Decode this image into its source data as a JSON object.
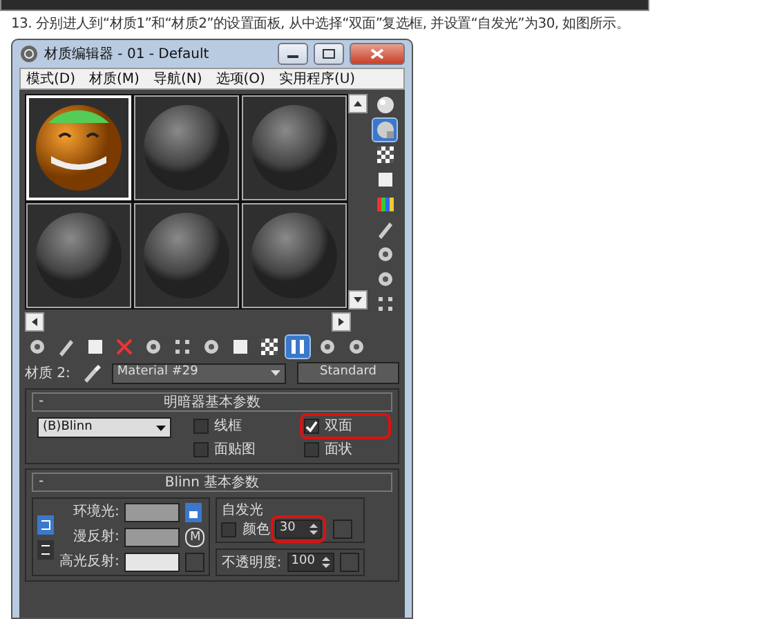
{
  "instruction": "13. 分别进人到“材质1”和“材质2”的设置面板, 从中选择“双面”复选框, 并设置“自发光”为30, 如图所示。",
  "window": {
    "title": "材质编辑器 - 01 - Default"
  },
  "menu": [
    "模式(D)",
    "材质(M)",
    "导航(N)",
    "选项(O)",
    "实用程序(U)"
  ],
  "samples": [
    {
      "kind": "textured",
      "selected": true
    },
    {
      "kind": "plain",
      "selected": false
    },
    {
      "kind": "plain",
      "selected": false
    },
    {
      "kind": "plain",
      "selected": false
    },
    {
      "kind": "plain",
      "selected": false
    },
    {
      "kind": "plain",
      "selected": false
    }
  ],
  "side_tools": [
    {
      "kind": "sphere",
      "selected": false
    },
    {
      "kind": "backlight",
      "selected": true
    },
    {
      "kind": "checker",
      "selected": false
    },
    {
      "kind": "square",
      "selected": false
    },
    {
      "kind": "colorbars",
      "selected": false
    },
    {
      "kind": "pen",
      "selected": false
    },
    {
      "kind": "cog",
      "selected": false
    },
    {
      "kind": "cog",
      "selected": false
    },
    {
      "kind": "dots",
      "selected": false
    }
  ],
  "toolbar": [
    {
      "kind": "cog",
      "selected": false
    },
    {
      "kind": "pen",
      "selected": false
    },
    {
      "kind": "square",
      "selected": false
    },
    {
      "kind": "delete",
      "selected": false
    },
    {
      "kind": "cog",
      "selected": false
    },
    {
      "kind": "dots",
      "selected": false
    },
    {
      "kind": "cog",
      "selected": false
    },
    {
      "kind": "square",
      "selected": false
    },
    {
      "kind": "checker",
      "selected": false
    },
    {
      "kind": "bars",
      "selected": true
    },
    {
      "kind": "cog",
      "selected": false
    },
    {
      "kind": "cog",
      "selected": false
    }
  ],
  "material": {
    "label": "材质 2:",
    "name": "Material #29",
    "type": "Standard"
  },
  "shader_rollout": {
    "collapse": "-",
    "title": "明暗器基本参数",
    "shader": "(B)Blinn",
    "options": [
      {
        "label": "线框",
        "checked": false,
        "highlighted": false
      },
      {
        "label": "双面",
        "checked": true,
        "highlighted": true
      },
      {
        "label": "面贴图",
        "checked": false,
        "highlighted": false
      },
      {
        "label": "面状",
        "checked": false,
        "highlighted": false
      }
    ]
  },
  "blinn_rollout": {
    "collapse": "-",
    "title": "Blinn 基本参数",
    "colors": [
      {
        "label": "环境光:",
        "color": "#999999"
      },
      {
        "label": "漫反射:",
        "color": "#999999"
      },
      {
        "label": "高光反射:",
        "color": "#e6e6e6"
      }
    ],
    "map_button": "M",
    "self_illum": {
      "title": "自发光",
      "label": "颜色",
      "checked": false,
      "value": "30",
      "highlighted": true
    },
    "opacity": {
      "label": "不透明度:",
      "value": "100"
    }
  }
}
